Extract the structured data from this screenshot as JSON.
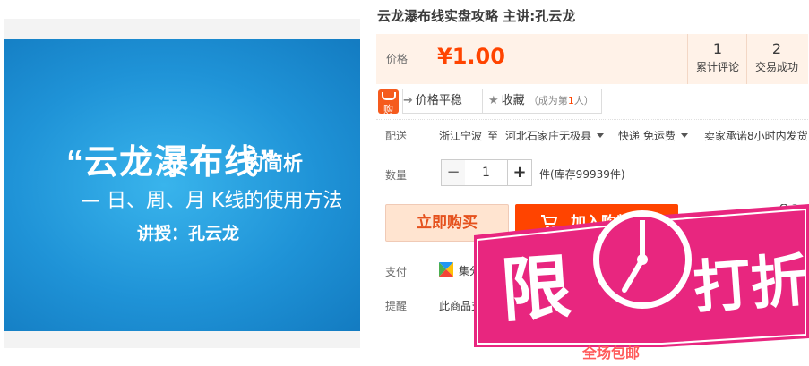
{
  "cover": {
    "title": "“云龙瀑布线”",
    "title_suffix": "的简析",
    "subtitle": "— 日、周、月 K线的使用方法",
    "author": "讲授：孔云龙"
  },
  "product": {
    "title": "云龙瀑布线实盘攻略 主讲:孔云龙",
    "price_label": "价格",
    "price": "¥1.00",
    "reviews": {
      "count": "1",
      "label": "累计评论"
    },
    "deals": {
      "count": "2",
      "label": "交易成功"
    }
  },
  "promo": {
    "buy_badge": "购",
    "price_stable": "价格平稳",
    "favorite": "收藏",
    "favorite_note_pre": "（成为第",
    "favorite_note_num": "1",
    "favorite_note_post": "人）"
  },
  "shipping": {
    "label": "配送",
    "from": "浙江宁波",
    "to_word": "至",
    "to": "河北石家庄无极县",
    "method": "快递 免运费",
    "promise": "卖家承诺8小时内发货"
  },
  "quantity": {
    "label": "数量",
    "minus": "−",
    "value": "1",
    "plus": "+",
    "stock": "件(库存99939件)"
  },
  "actions": {
    "buy_now": "立即购买",
    "add_cart": "加入购物车"
  },
  "payment": {
    "label": "支付",
    "text": "集分"
  },
  "remind": {
    "label": "提醒",
    "text": "此商品支"
  },
  "badge": {
    "text_main": "限",
    "text_rest": "打折",
    "subtext": "全场包邮"
  },
  "colors": {
    "accent": "#ff4400",
    "cover_blue": "#1f93d7",
    "badge_pink": "#e8267f"
  }
}
